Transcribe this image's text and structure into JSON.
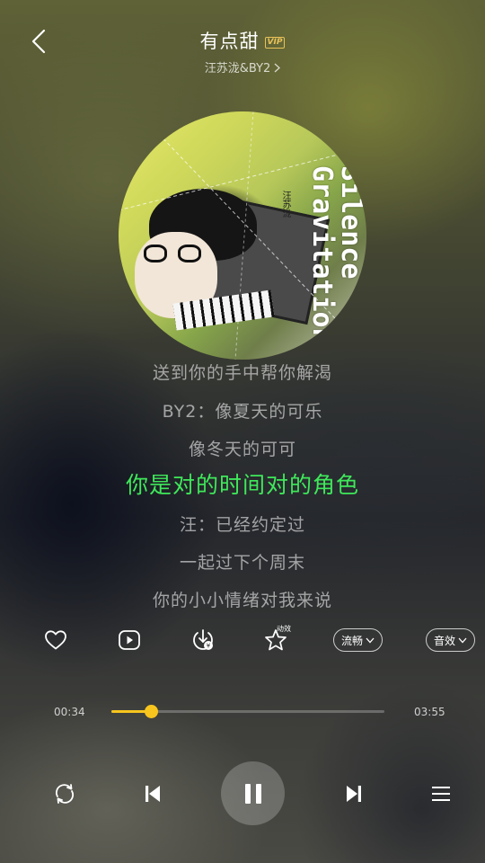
{
  "header": {
    "title": "有点甜",
    "vip_badge": "VIP",
    "artist": "汪苏泷&BY2"
  },
  "album": {
    "cover_text": "Silence Gravitation",
    "cover_small_text": "汪苏泷"
  },
  "lyrics": {
    "lines": [
      "送到你的手中帮你解渴",
      "BY2：像夏天的可乐",
      "像冬天的可可",
      "你是对的时间对的角色",
      "汪：已经约定过",
      "一起过下个周末",
      "你的小小情绪对我来说"
    ],
    "active_index": 3,
    "active_color": "#3fe85a"
  },
  "actions": {
    "icons": [
      "heart-icon",
      "play-video-icon",
      "download-icon",
      "effect-star-icon"
    ],
    "effect_badge": "动效",
    "quality_label": "流畅",
    "sound_effect_label": "音效"
  },
  "progress": {
    "current_time": "00:34",
    "total_time": "03:55",
    "fraction": 0.145,
    "accent_color": "#f7c51e"
  },
  "controls": {
    "icons": [
      "repeat-icon",
      "previous-icon",
      "pause-icon",
      "next-icon",
      "playlist-icon"
    ],
    "is_playing": true
  }
}
